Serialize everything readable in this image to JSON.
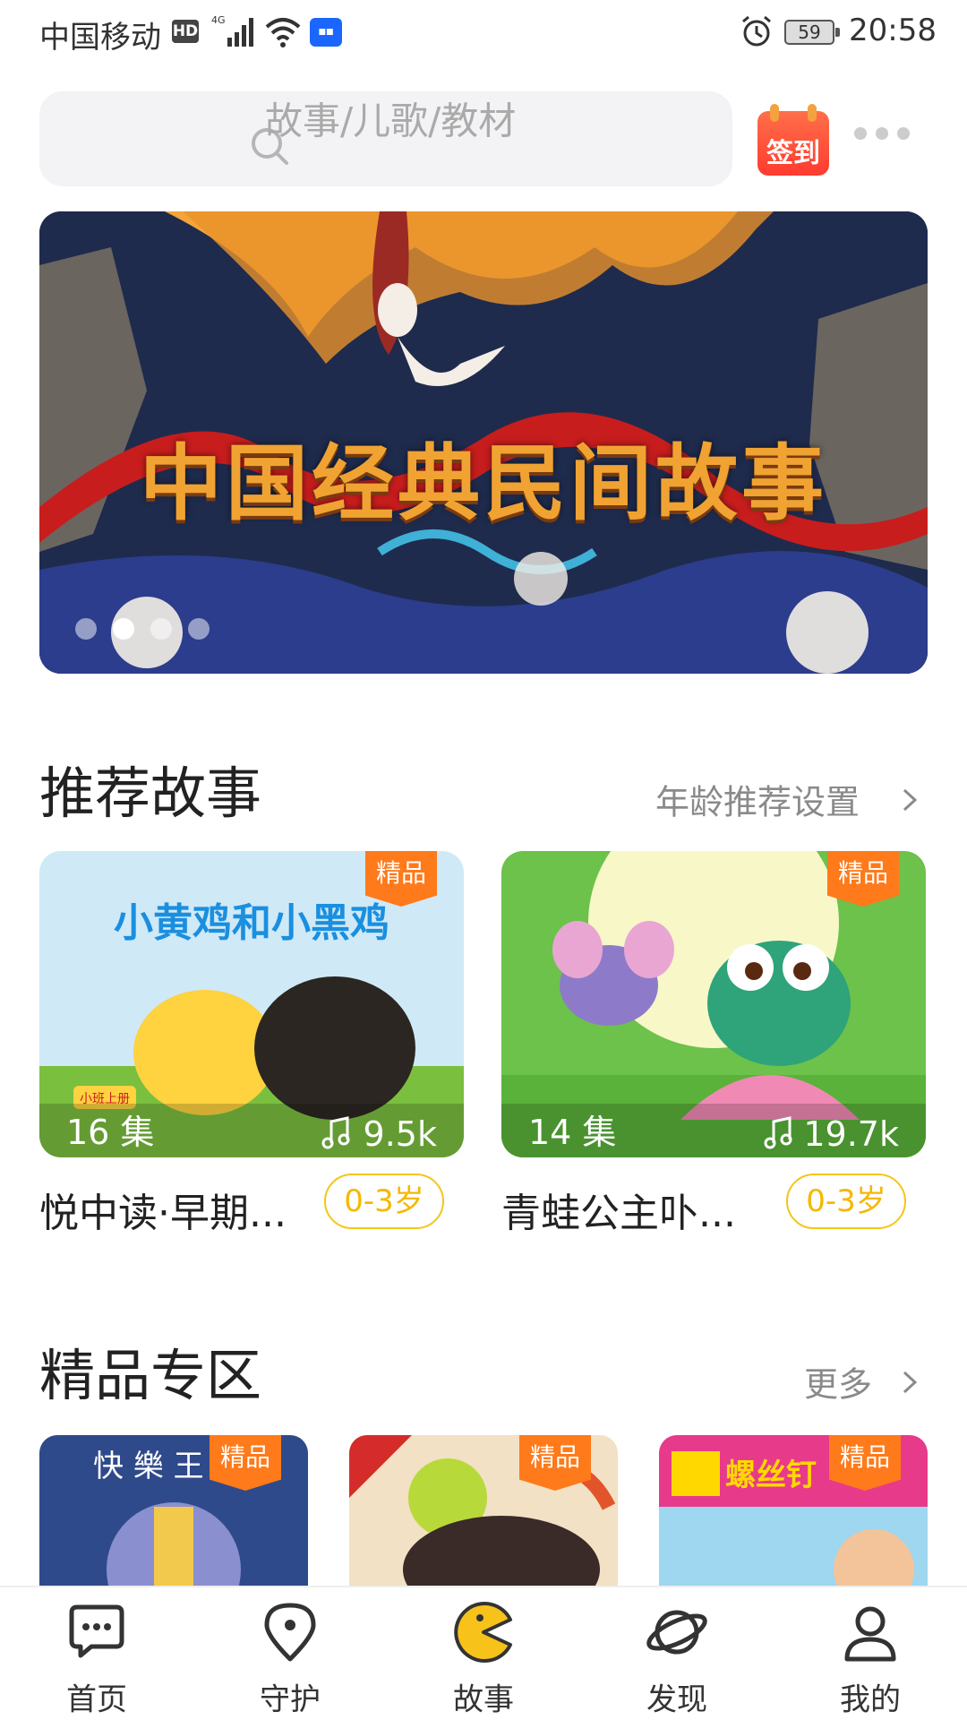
{
  "status_bar": {
    "carrier": "中国移动",
    "hd": "HD",
    "network": "4G",
    "battery": "59",
    "time": "20:58"
  },
  "search": {
    "placeholder": "故事/儿歌/教材",
    "icon": "search-icon"
  },
  "checkin": {
    "label": "签到"
  },
  "banner": {
    "title": "中国经典民间故事",
    "slide_count": 4,
    "active_slide": 2
  },
  "recommended": {
    "title": "推荐故事",
    "link": "年龄推荐设置",
    "items": [
      {
        "title": "悦中读·早期...",
        "badge": "精品",
        "episodes": "16 集",
        "plays": "9.5k",
        "age": "0-3岁"
      },
      {
        "title": "青蛙公主卟...",
        "badge": "精品",
        "episodes": "14 集",
        "plays": "19.7k",
        "age": "0-3岁"
      }
    ]
  },
  "premium": {
    "title": "精品专区",
    "link": "更多",
    "items": [
      {
        "badge": "精品"
      },
      {
        "badge": "精品"
      },
      {
        "badge": "精品"
      }
    ]
  },
  "tabs": [
    {
      "label": "首页",
      "icon": "chat-bubble-icon"
    },
    {
      "label": "守护",
      "icon": "location-pin-icon"
    },
    {
      "label": "故事",
      "icon": "pacman-icon",
      "active": true
    },
    {
      "label": "发现",
      "icon": "planet-icon"
    },
    {
      "label": "我的",
      "icon": "person-icon"
    }
  ],
  "colors": {
    "accent_orange": "#ff7a1a",
    "age_tag_yellow": "#f5c518",
    "active_tab_yellow": "#f7c31a"
  }
}
